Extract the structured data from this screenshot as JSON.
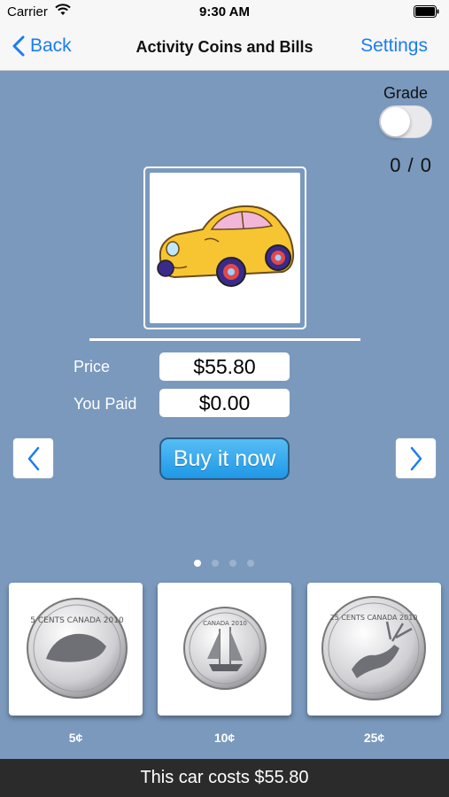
{
  "status_bar": {
    "carrier": "Carrier",
    "time": "9:30 AM"
  },
  "nav": {
    "back_label": "Back",
    "title": "Activity Coins and Bills",
    "settings_label": "Settings"
  },
  "grade": {
    "label": "Grade",
    "toggle_on": false,
    "score": "0 / 0"
  },
  "item": {
    "image": "car-illustration"
  },
  "price": {
    "label": "Price",
    "value": "$55.80"
  },
  "paid": {
    "label": "You Paid",
    "value": "$0.00"
  },
  "buy_button_label": "Buy it now",
  "pager": {
    "pages": 4,
    "current": 1
  },
  "coins": [
    {
      "label": "5¢",
      "icon": "nickel-coin",
      "text": "5 CENTS CANADA 2010"
    },
    {
      "label": "10¢",
      "icon": "dime-coin",
      "text": "CANADA 2010"
    },
    {
      "label": "25¢",
      "icon": "quarter-coin",
      "text": "25 CENTS CANADA 2010"
    }
  ],
  "message": "This car costs $55.80",
  "colors": {
    "background": "#7a99bd",
    "accent": "#1a7cf5",
    "buy_button": "#2aa3ee",
    "bottom_bar": "#2b2b2b"
  }
}
